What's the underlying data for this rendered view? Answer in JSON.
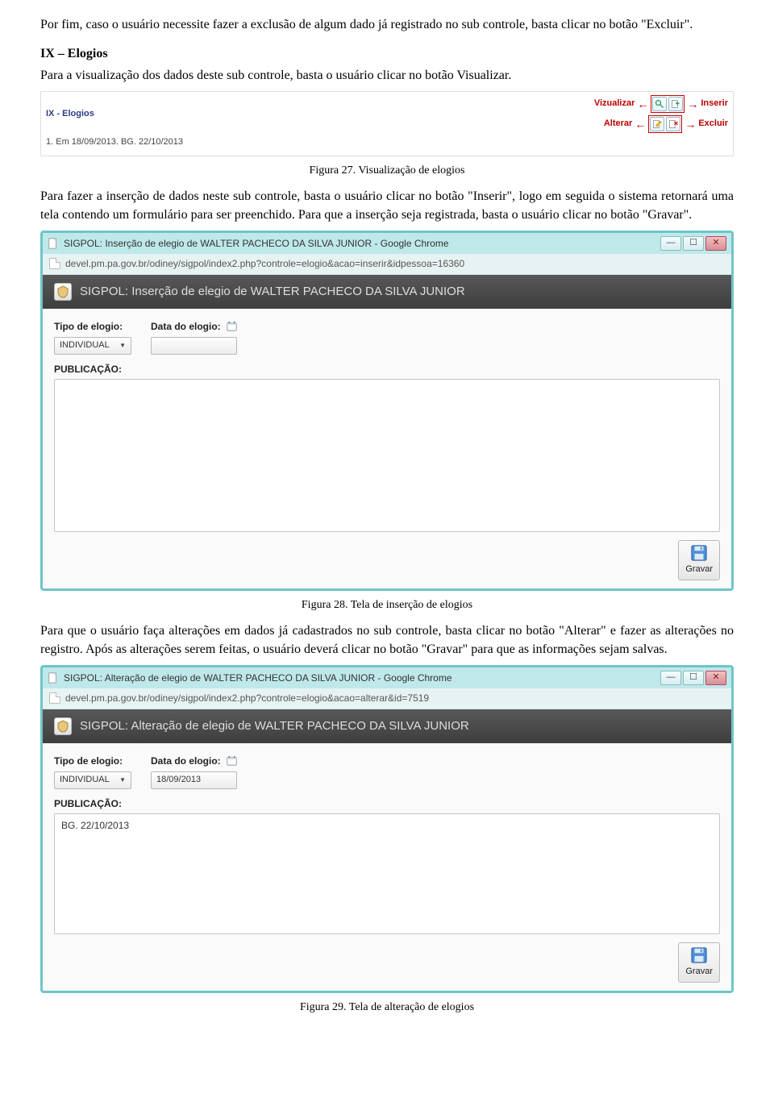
{
  "para1": "Por fim, caso o usuário necessite fazer a exclusão de algum dado já registrado no sub controle, basta clicar no botão \"Excluir\".",
  "heading1": "IX – Elogios",
  "para2": "Para a visualização dos dados deste sub controle, basta o usuário clicar no botão Visualizar.",
  "fig27": {
    "section_title": "IX - Elogios",
    "item": "1. Em 18/09/2013. BG. 22/10/2013",
    "vizualizar": "Vizualizar",
    "inserir": "Inserir",
    "alterar": "Alterar",
    "excluir": "Excluir"
  },
  "caption27": "Figura 27. Visualização de elogios",
  "para3": "Para fazer a inserção de dados neste sub controle, basta o usuário clicar no botão \"Inserir\", logo em seguida o sistema retornará uma tela contendo um formulário para ser preenchido. Para que a inserção seja registrada, basta o usuário clicar no botão \"Gravar\".",
  "popup28": {
    "wintitle": "SIGPOL: Inserção de elegio de WALTER PACHECO DA SILVA JUNIOR - Google Chrome",
    "url": "devel.pm.pa.gov.br/odiney/sigpol/index2.php?controle=elogio&acao=inserir&idpessoa=16360",
    "apptitle": "SIGPOL: Inserção de elegio de WALTER PACHECO DA SILVA JUNIOR",
    "tipo_label": "Tipo de elogio:",
    "tipo_value": "INDIVIDUAL",
    "data_label": "Data do elogio:",
    "data_value": "",
    "pub_label": "PUBLICAÇÃO:",
    "pub_value": "",
    "gravar": "Gravar"
  },
  "caption28": "Figura 28. Tela de inserção de elogios",
  "para4": "Para que o usuário faça alterações em dados já cadastrados no sub controle, basta clicar no botão \"Alterar\" e fazer as alterações no registro. Após as alterações serem feitas, o usuário deverá clicar no botão \"Gravar\" para que as informações sejam salvas.",
  "popup29": {
    "wintitle": "SIGPOL: Alteração de elegio de WALTER PACHECO DA SILVA JUNIOR - Google Chrome",
    "url": "devel.pm.pa.gov.br/odiney/sigpol/index2.php?controle=elogio&acao=alterar&id=7519",
    "apptitle": "SIGPOL: Alteração de elegio de WALTER PACHECO DA SILVA JUNIOR",
    "tipo_label": "Tipo de elogio:",
    "tipo_value": "INDIVIDUAL",
    "data_label": "Data do elogio:",
    "data_value": "18/09/2013",
    "pub_label": "PUBLICAÇÃO:",
    "pub_value": "BG. 22/10/2013",
    "gravar": "Gravar"
  },
  "caption29": "Figura 29. Tela de alteração de elogios"
}
